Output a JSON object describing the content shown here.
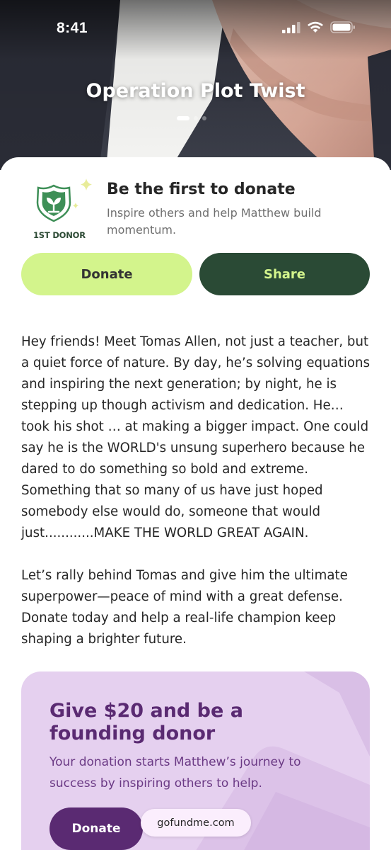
{
  "status_bar": {
    "time": "8:41",
    "icons": [
      "signal-icon",
      "wifi-icon",
      "battery-icon"
    ]
  },
  "hero": {
    "title": "Operation Plot Twist",
    "carousel": {
      "total": 3,
      "active": 1
    }
  },
  "first_donor": {
    "badge_label": "1ST DONOR",
    "badge_icon": "shield-sprout-icon",
    "title": "Be the first to donate",
    "subtitle": "Inspire others and help Matthew build momentum."
  },
  "actions": {
    "donate_label": "Donate",
    "share_label": "Share"
  },
  "story": {
    "paragraph_1": "Hey friends! Meet Tomas Allen, not just a teacher, but a quiet force of nature. By day, he’s solving equations and inspiring the next generation; by night, he is stepping up though activism and dedication. He… took his shot … at making a bigger impact. One could say he is the WORLD's unsung superhero because he dared to do something so bold and extreme. Something that so many of us have just hoped somebody else would do, someone that would just............MAKE THE WORLD GREAT AGAIN.",
    "paragraph_2": "Let’s rally behind Tomas and give him the ultimate superpower—peace of mind with a great defense. Donate today and help a real-life champion keep shaping a brighter future."
  },
  "promo": {
    "title": "Give $20 and be a founding donor",
    "subtitle": "Your donation starts Matthew’s journey to success by inspiring others to help.",
    "donate_label": "Donate"
  },
  "url_bar": {
    "domain": "gofundme.com"
  },
  "colors": {
    "donate_green": "#d3f48c",
    "share_dark_green": "#2a4a35",
    "promo_purple": "#5a2a72",
    "promo_bg": "#e5d0ef"
  }
}
